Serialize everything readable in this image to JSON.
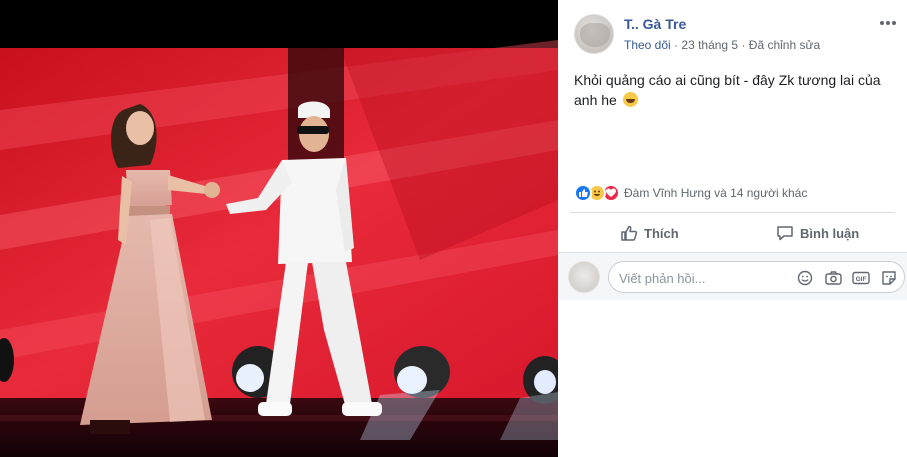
{
  "post": {
    "author": "T.. Gà Tre",
    "follow_label": "Theo dõi",
    "separator": "·",
    "date": "23 tháng 5",
    "edited": "Đã chỉnh sửa",
    "text": "Khỏi quảng cáo ai cũng bít - đây Zk tương lai của anh he"
  },
  "reactions": {
    "types": [
      "like",
      "haha",
      "love"
    ],
    "summary": "Đàm Vĩnh Hưng và 14 người khác"
  },
  "actions": {
    "like_label": "Thích",
    "comment_label": "Bình luận"
  },
  "comment_box": {
    "placeholder": "Viết phản hồi...",
    "icons": [
      "emoji-icon",
      "camera-icon",
      "gif-icon",
      "sticker-icon"
    ]
  },
  "colors": {
    "link": "#385898",
    "meta": "#616770",
    "stage_red": "#e01b2a",
    "like_blue": "#1877f2"
  }
}
